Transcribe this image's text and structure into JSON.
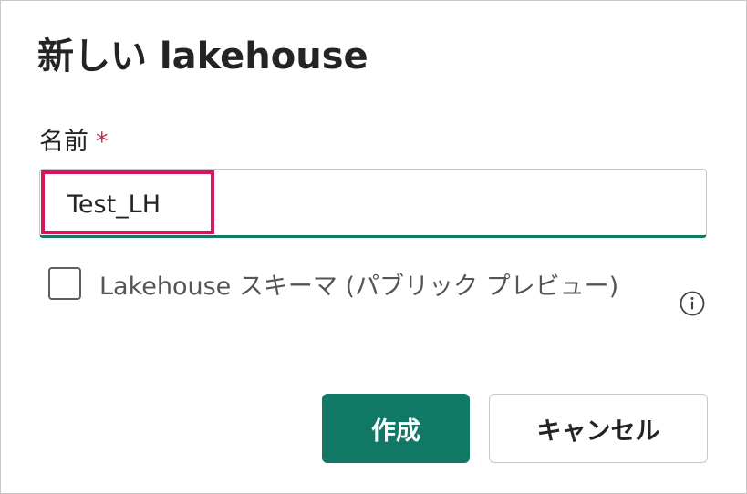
{
  "dialog": {
    "title": "新しい lakehouse",
    "name_field": {
      "label": "名前",
      "required_mark": "*",
      "value": "Test_LH"
    },
    "schema_option": {
      "label": "Lakehouse スキーマ (パブリック プレビュー)",
      "checked": false,
      "info_icon": "info-icon"
    },
    "buttons": {
      "create_label": "作成",
      "cancel_label": "キャンセル"
    }
  },
  "colors": {
    "accent": "#117865",
    "required": "#c4314b",
    "highlight": "#d3175f",
    "text": "#242424"
  }
}
